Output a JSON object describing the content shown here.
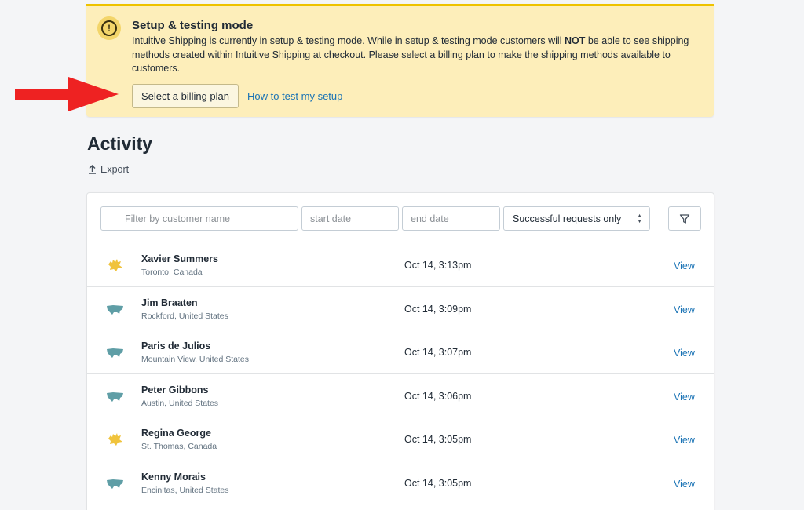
{
  "banner": {
    "title": "Setup & testing mode",
    "body_before_bold": "Intuitive Shipping is currently in setup & testing mode. While in setup & testing mode customers will ",
    "body_bold": "NOT",
    "body_after_bold": " be able to see shipping methods created within Intuitive Shipping at checkout. Please select a billing plan to make the shipping methods available to customers.",
    "primary_button": "Select a billing plan",
    "secondary_link": "How to test my setup",
    "icon": "alert-circle-icon",
    "accent_color": "#eec200",
    "background_color": "#fdeeba"
  },
  "annotation": {
    "arrow_color": "#ee2222"
  },
  "activity": {
    "title": "Activity",
    "export_label": "Export"
  },
  "filters": {
    "search_placeholder": "Filter by customer name",
    "start_placeholder": "start date",
    "end_placeholder": "end date",
    "status_selected": "Successful requests only"
  },
  "rows": [
    {
      "name": "Xavier Summers",
      "location": "Toronto, Canada",
      "time": "Oct 14, 3:13pm",
      "action": "View",
      "flag": "canada-map-icon"
    },
    {
      "name": "Jim Braaten",
      "location": "Rockford, United States",
      "time": "Oct 14, 3:09pm",
      "action": "View",
      "flag": "usa-map-icon"
    },
    {
      "name": "Paris de Julios",
      "location": "Mountain View, United States",
      "time": "Oct 14, 3:07pm",
      "action": "View",
      "flag": "usa-map-icon"
    },
    {
      "name": "Peter Gibbons",
      "location": "Austin, United States",
      "time": "Oct 14, 3:06pm",
      "action": "View",
      "flag": "usa-map-icon"
    },
    {
      "name": "Regina George",
      "location": "St. Thomas, Canada",
      "time": "Oct 14, 3:05pm",
      "action": "View",
      "flag": "canada-map-icon"
    },
    {
      "name": "Kenny Morais",
      "location": "Encinitas, United States",
      "time": "Oct 14, 3:05pm",
      "action": "View",
      "flag": "usa-map-icon"
    }
  ],
  "colors": {
    "link": "#1a73b5",
    "canada_map": "#f0c33c",
    "usa_map": "#5f9ea6"
  }
}
